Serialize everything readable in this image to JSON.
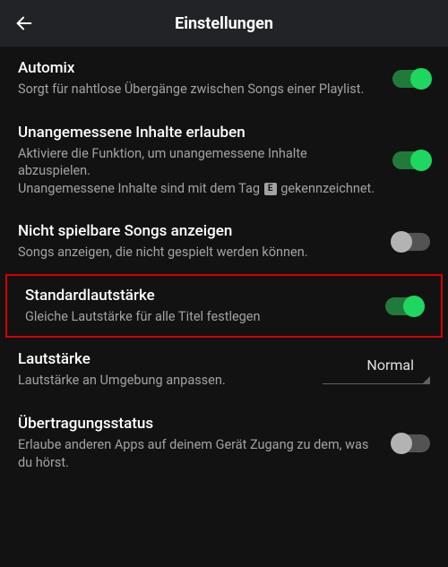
{
  "header": {
    "title": "Einstellungen"
  },
  "settings": [
    {
      "key": "automix",
      "title": "Automix",
      "desc": "Sorgt für nahtlose Übergänge zwischen Songs einer Playlist.",
      "control": "toggle",
      "value": true
    },
    {
      "key": "explicit",
      "title": "Unangemessene Inhalte erlauben",
      "desc_before": "Aktiviere die Funktion, um unangemessene Inhalte abzuspielen.\nUnangemessene Inhalte sind mit dem Tag ",
      "desc_after": " gekennzeichnet.",
      "badge": "E",
      "control": "toggle",
      "value": true
    },
    {
      "key": "unplayable",
      "title": "Nicht spielbare Songs anzeigen",
      "desc": "Songs anzeigen, die nicht gespielt werden können.",
      "control": "toggle",
      "value": false
    },
    {
      "key": "normalize",
      "title": "Standardlautstärke",
      "desc": "Gleiche Lautstärke für alle Titel festlegen",
      "control": "toggle",
      "value": true,
      "highlighted": true
    },
    {
      "key": "volume-level",
      "title": "Lautstärke",
      "desc": "Lautstärke an Umgebung anpassen.",
      "control": "select",
      "value": "Normal"
    },
    {
      "key": "broadcast",
      "title": "Übertragungsstatus",
      "desc": "Erlaube anderen Apps auf deinem Gerät Zugang zu dem, was du hörst.",
      "control": "toggle",
      "value": false
    }
  ]
}
